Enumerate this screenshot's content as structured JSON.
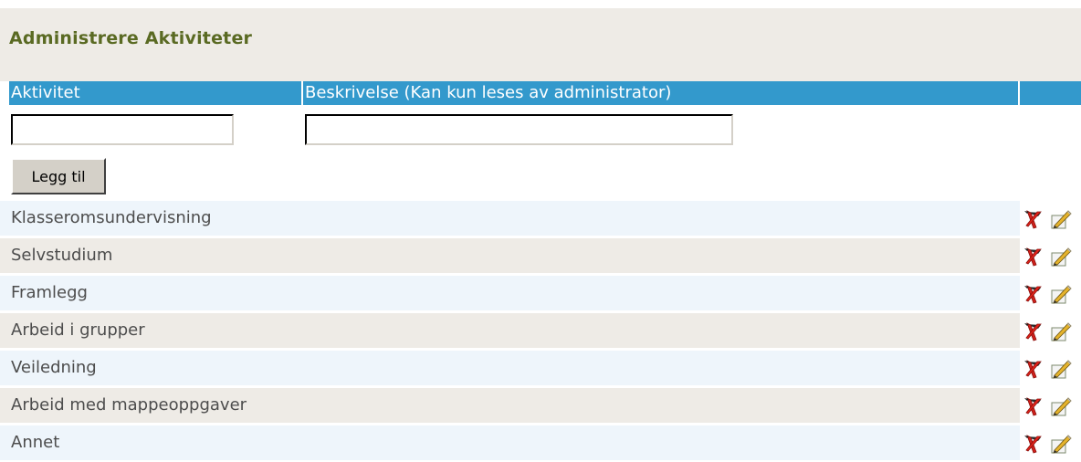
{
  "page": {
    "title": "Administrere Aktiviteter"
  },
  "table": {
    "headers": [
      "Aktivitet",
      "Beskrivelse (Kan kun leses av administrator)",
      ""
    ],
    "add_button": "Legg til",
    "rows": [
      {
        "activity": "Klasseromsundervisning",
        "description": ""
      },
      {
        "activity": "Selvstudium",
        "description": ""
      },
      {
        "activity": "Framlegg",
        "description": ""
      },
      {
        "activity": "Arbeid i grupper",
        "description": ""
      },
      {
        "activity": "Veiledning",
        "description": ""
      },
      {
        "activity": "Arbeid med mappeoppgaver",
        "description": ""
      },
      {
        "activity": "Annet",
        "description": ""
      }
    ]
  },
  "icons": {
    "delete": "delete-icon",
    "edit": "edit-pencil-icon"
  },
  "colors": {
    "header": "#3399cc",
    "title": "#5a6a23",
    "row_alt_a": "#eef5fb",
    "row_alt_b": "#eeebe6"
  }
}
